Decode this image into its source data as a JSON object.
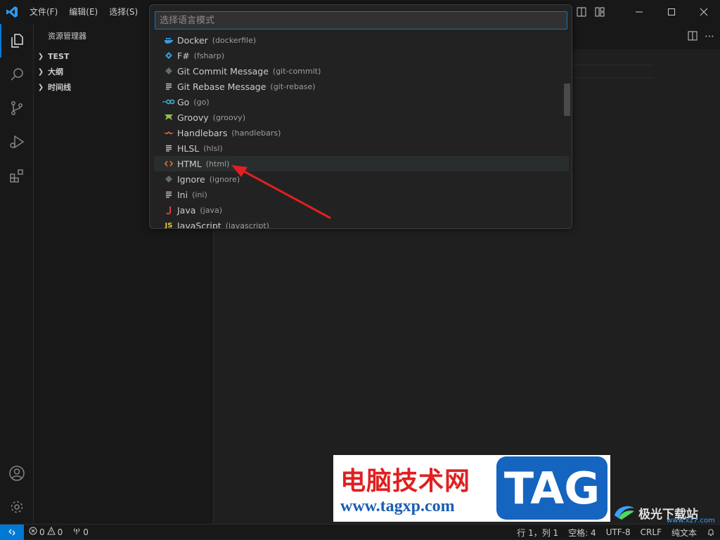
{
  "titlebar": {
    "menu": [
      "文件(F)",
      "编辑(E)",
      "选择(S)"
    ]
  },
  "sidebar": {
    "title": "资源管理器",
    "sections": [
      "TEST",
      "大纲",
      "时间线"
    ]
  },
  "quick_pick": {
    "placeholder": "选择语言模式",
    "items": [
      {
        "label": "Docker",
        "id": "(dockerfile)",
        "icon": "docker-icon"
      },
      {
        "label": "F#",
        "id": "(fsharp)",
        "icon": "fsharp-icon"
      },
      {
        "label": "Git Commit Message",
        "id": "(git-commit)",
        "icon": "git-icon"
      },
      {
        "label": "Git Rebase Message",
        "id": "(git-rebase)",
        "icon": "lines-icon"
      },
      {
        "label": "Go",
        "id": "(go)",
        "icon": "go-icon"
      },
      {
        "label": "Groovy",
        "id": "(groovy)",
        "icon": "groovy-icon"
      },
      {
        "label": "Handlebars",
        "id": "(handlebars)",
        "icon": "handlebars-icon"
      },
      {
        "label": "HLSL",
        "id": "(hlsl)",
        "icon": "lines-icon"
      },
      {
        "label": "HTML",
        "id": "(html)",
        "icon": "html-icon",
        "selected": true
      },
      {
        "label": "Ignore",
        "id": "(ignore)",
        "icon": "git-icon"
      },
      {
        "label": "Ini",
        "id": "(ini)",
        "icon": "lines-icon"
      },
      {
        "label": "Java",
        "id": "(java)",
        "icon": "java-icon"
      },
      {
        "label": "JavaScript",
        "id": "(javascript)",
        "icon": "js-icon"
      }
    ]
  },
  "statusbar": {
    "errors": "0",
    "warnings": "0",
    "ports": "0",
    "position": "行 1，列 1",
    "spaces": "空格: 4",
    "encoding": "UTF-8",
    "eol": "CRLF",
    "language": "纯文本"
  },
  "watermark": {
    "title": "电脑技术网",
    "url": "www.tagxp.com",
    "tag": "TAG",
    "site_name": "极光下载站",
    "site_url": "www.xz7.com"
  },
  "colors": {
    "accent": "#0078d4",
    "arrow": "#e02020"
  }
}
